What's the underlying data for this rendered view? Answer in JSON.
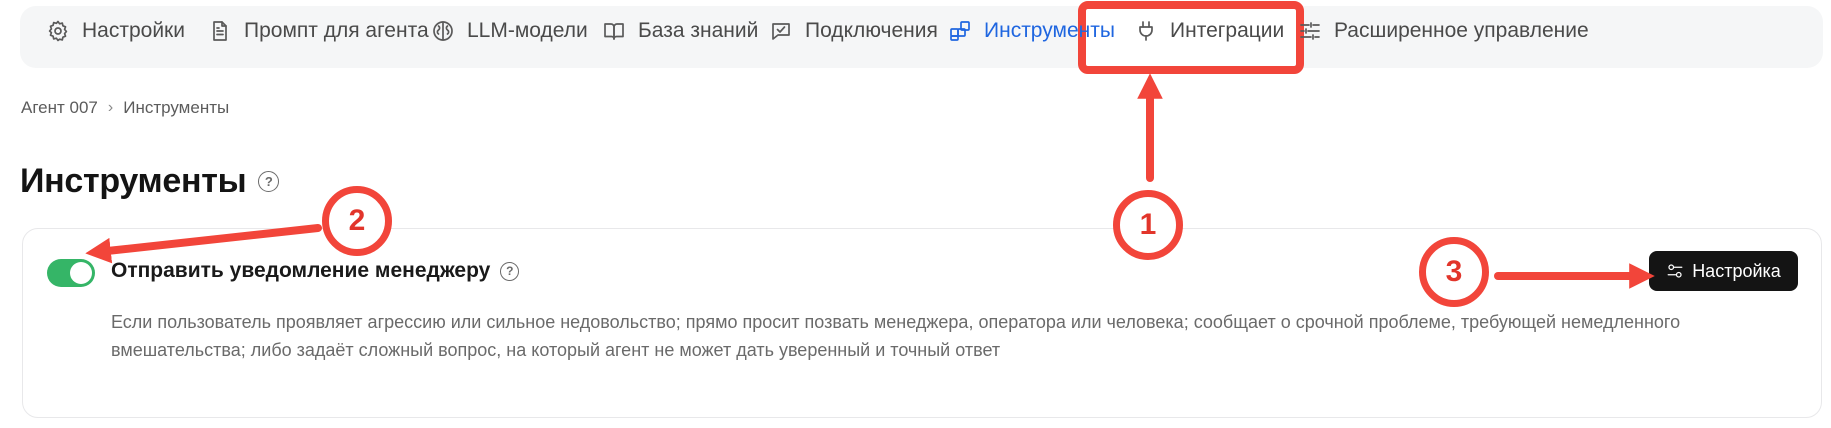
{
  "tabs": [
    {
      "label": "Настройки",
      "icon": "gear-icon"
    },
    {
      "label": "Промпт для агента",
      "icon": "document-icon"
    },
    {
      "label": "LLM-модели",
      "icon": "brain-icon"
    },
    {
      "label": "База знаний",
      "icon": "book-icon"
    },
    {
      "label": "Подключения",
      "icon": "checkbox-icon"
    },
    {
      "label": "Инструменты",
      "icon": "grid-icon",
      "active": true
    },
    {
      "label": "Интеграции",
      "icon": "plug-icon"
    },
    {
      "label": "Расширенное управление",
      "icon": "sliders-icon"
    }
  ],
  "breadcrumb": {
    "parent": "Агент 007",
    "separator": "›",
    "current": "Инструменты"
  },
  "page": {
    "title": "Инструменты",
    "help_icon": "question-circle-icon"
  },
  "tool": {
    "enabled": true,
    "name": "Отправить уведомление менеджеру",
    "description": "Если пользователь проявляет агрессию или сильное недовольство; прямо просит позвать менеджера, оператора или человека; сообщает о срочной проблеме, требующей немедленного вмешательства; либо задаёт сложный вопрос, на который агент не может дать уверенный и точный ответ",
    "settings_label": "Настройка"
  },
  "annotations": {
    "badges": [
      "1",
      "2",
      "3"
    ],
    "color": "#f2453a"
  },
  "colors": {
    "accent": "#1f66e0",
    "toggle_on": "#35b567",
    "button_dark": "#141414"
  }
}
